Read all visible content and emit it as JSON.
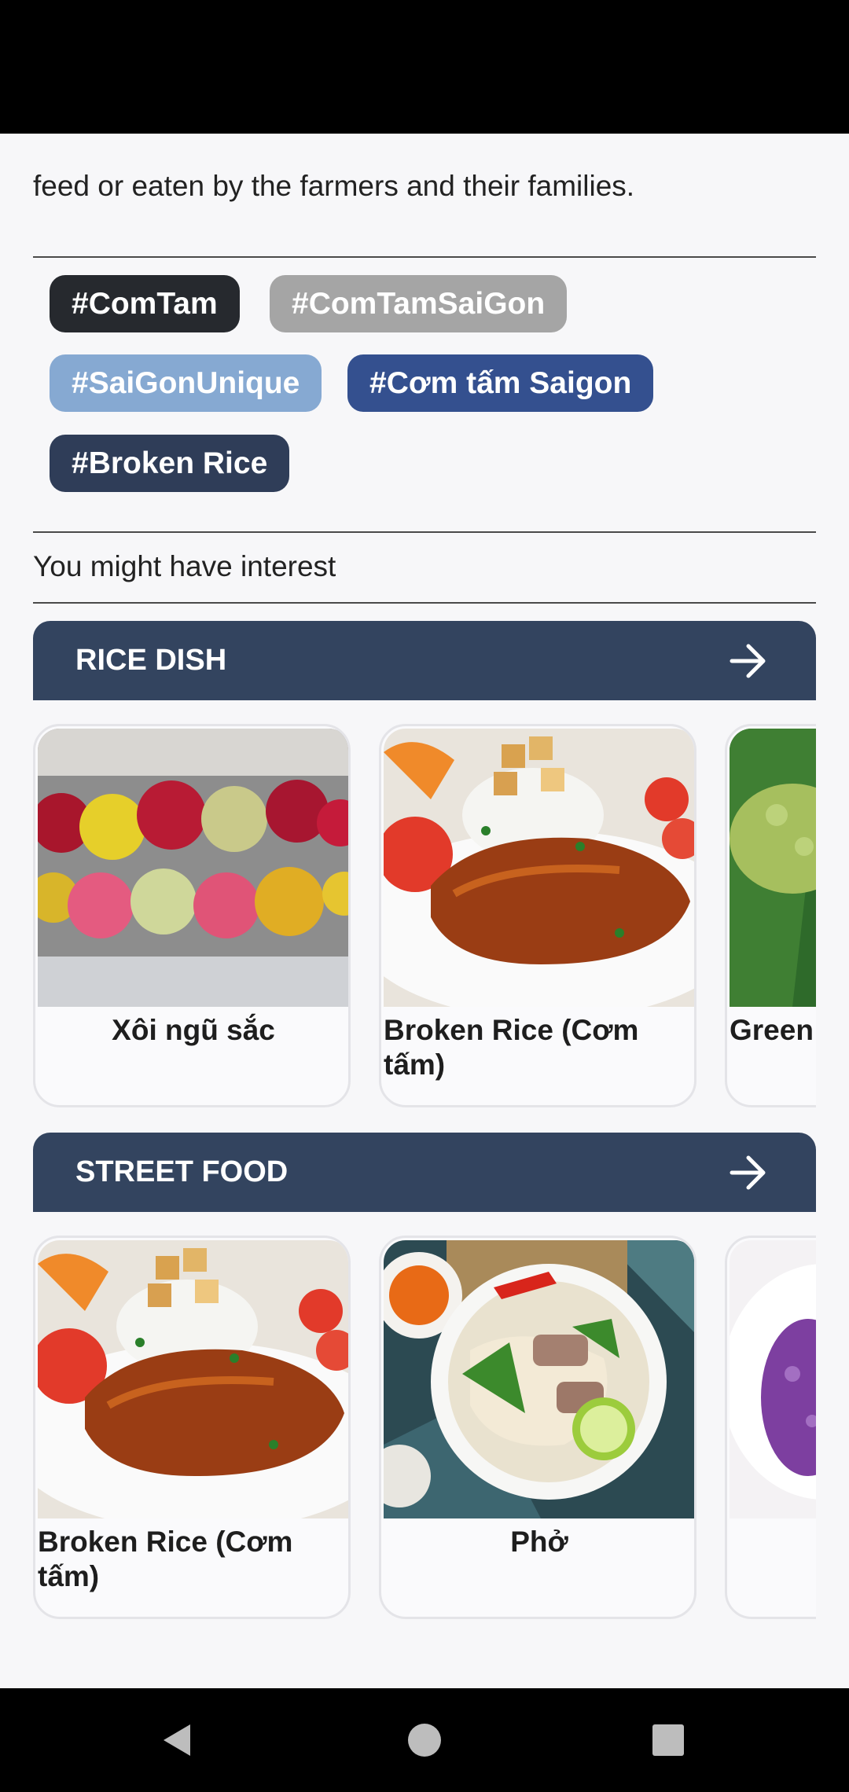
{
  "article": {
    "tail_text": "feed or eaten by the farmers and their families."
  },
  "tags": [
    {
      "label": "#ComTam",
      "color": "#26292e"
    },
    {
      "label": "#ComTamSaiGon",
      "color": "#a5a5a5"
    },
    {
      "label": "#SaiGonUnique",
      "color": "#86a9d2"
    },
    {
      "label": "#Cơm tấm Saigon",
      "color": "#34508f"
    },
    {
      "label": "#Broken Rice",
      "color": "#2f3d58"
    }
  ],
  "recommendations": {
    "title": "You might have interest",
    "categories": [
      {
        "label": "RICE DISH",
        "action_icon": "arrow-right-icon",
        "items": [
          {
            "name": "Xôi ngũ sắc",
            "image": "colorful-sticky-rice-image"
          },
          {
            "name": "Broken Rice (Cơm tấm)",
            "image": "broken-rice-image"
          },
          {
            "name": "Green (Cốm)",
            "image": "green-rice-flakes-image"
          }
        ]
      },
      {
        "label": "STREET FOOD",
        "action_icon": "arrow-right-icon",
        "items": [
          {
            "name": "Broken Rice (Cơm tấm)",
            "image": "broken-rice-image"
          },
          {
            "name": "Phở",
            "image": "pho-noodle-soup-image"
          },
          {
            "name": "",
            "image": "purple-sticky-rice-image"
          }
        ]
      }
    ]
  },
  "colors": {
    "header_bg": "#33445f",
    "page_bg": "#f7f7f9"
  },
  "nav": {
    "back_icon": "back-triangle-icon",
    "home_icon": "home-circle-icon",
    "recents_icon": "recents-square-icon"
  }
}
